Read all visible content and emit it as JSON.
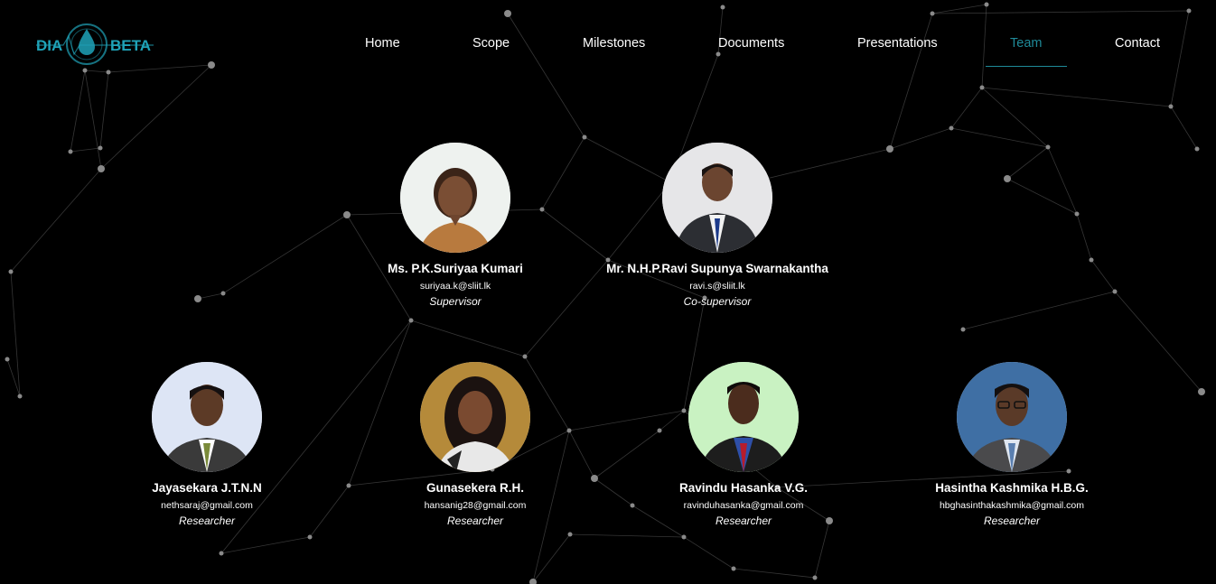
{
  "brand": {
    "logo_left": "DIA",
    "logo_right": "BETA",
    "color": "#1fa3b8"
  },
  "nav": {
    "items": [
      {
        "label": "Home"
      },
      {
        "label": "Scope"
      },
      {
        "label": "Milestones"
      },
      {
        "label": "Documents"
      },
      {
        "label": "Presentations"
      },
      {
        "label": "Team",
        "active": true
      },
      {
        "label": "Contact"
      }
    ],
    "active_color": "#1f8a99"
  },
  "supervisors": [
    {
      "name": "Ms. P.K.Suriyaa Kumari",
      "email": "suriyaa.k@sliit.lk",
      "role": "Supervisor"
    },
    {
      "name": "Mr. N.H.P.Ravi Supunya Swarnakantha",
      "email": "ravi.s@sliit.lk",
      "role": "Co-supervisor"
    }
  ],
  "researchers": [
    {
      "name": "Jayasekara J.T.N.N",
      "email": "nethsaraj@gmail.com",
      "role": "Researcher"
    },
    {
      "name": "Gunasekera R.H.",
      "email": "hansanig28@gmail.com",
      "role": "Researcher"
    },
    {
      "name": "Ravindu Hasanka V.G.",
      "email": "ravinduhasanka@gmail.com",
      "role": "Researcher"
    },
    {
      "name": "Hasintha Kashmika H.B.G.",
      "email": "hbghasinthakashmika@gmail.com",
      "role": "Researcher"
    }
  ]
}
